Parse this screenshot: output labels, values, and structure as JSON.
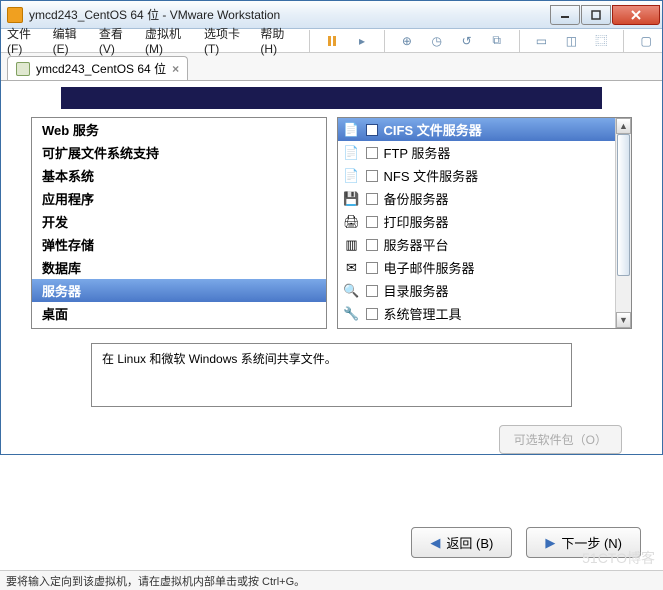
{
  "window": {
    "title": "ymcd243_CentOS 64 位 - VMware Workstation"
  },
  "menu": {
    "file": "文件(F)",
    "edit": "编辑(E)",
    "view": "查看(V)",
    "vm": "虚拟机(M)",
    "tabs": "选项卡(T)",
    "help": "帮助(H)"
  },
  "tab": {
    "label": "ymcd243_CentOS 64 位"
  },
  "categories": [
    "Web 服务",
    "可扩展文件系统支持",
    "基本系统",
    "应用程序",
    "开发",
    "弹性存储",
    "数据库",
    "服务器",
    "桌面"
  ],
  "cat_selected": 7,
  "services": [
    {
      "label": "CIFS 文件服务器",
      "selected": true
    },
    {
      "label": "FTP 服务器"
    },
    {
      "label": "NFS 文件服务器"
    },
    {
      "label": "备份服务器"
    },
    {
      "label": "打印服务器"
    },
    {
      "label": "服务器平台"
    },
    {
      "label": "电子邮件服务器"
    },
    {
      "label": "目录服务器"
    },
    {
      "label": "系统管理工具"
    }
  ],
  "description": "在 Linux 和微软 Windows 系统间共享文件。",
  "buttons": {
    "optional": "可选软件包（O）",
    "back": "返回 (B)",
    "next": "下一步 (N)"
  },
  "status": "要将输入定向到该虚拟机，请在虚拟机内部单击或按 Ctrl+G。",
  "watermark": "51CTO博客"
}
